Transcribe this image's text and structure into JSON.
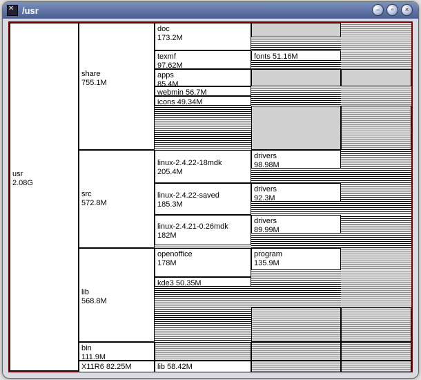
{
  "window": {
    "title": "/usr"
  },
  "root": {
    "name": "usr",
    "size": "2.08G"
  },
  "l2": {
    "share": {
      "name": "share",
      "size": "755.1M"
    },
    "src": {
      "name": "src",
      "size": "572.8M"
    },
    "lib": {
      "name": "lib",
      "size": "568.8M"
    },
    "bin": {
      "name": "bin",
      "size": "111.9M"
    },
    "x11r6": {
      "name": "X11R6 82.25M"
    }
  },
  "l3": {
    "doc": {
      "name": "doc",
      "size": "173.2M"
    },
    "texmf": {
      "name": "texmf",
      "size": "97.62M"
    },
    "apps": {
      "name": "apps",
      "size": "85.4M"
    },
    "webmin": {
      "label": "webmin 56.7M"
    },
    "icons": {
      "label": "icons 49.34M"
    },
    "linux1": {
      "name": "linux-2.4.22-18mdk",
      "size": "205.4M"
    },
    "linux2": {
      "name": "linux-2.4.22-saved",
      "size": "185.3M"
    },
    "linux3": {
      "name": "linux-2.4.21-0.26mdk",
      "size": "182M"
    },
    "openoffice": {
      "name": "openoffice",
      "size": "178M"
    },
    "kde3": {
      "label": "kde3 50.35M"
    },
    "x11lib": {
      "label": "lib 58.42M"
    }
  },
  "l4": {
    "fonts": {
      "label": "fonts 51.16M"
    },
    "drivers1": {
      "name": "drivers",
      "size": "98.98M"
    },
    "drivers2": {
      "name": "drivers",
      "size": "92.3M"
    },
    "drivers3": {
      "name": "drivers",
      "size": "89.99M"
    },
    "program": {
      "name": "program",
      "size": "135.9M"
    }
  },
  "chart_data": {
    "type": "treemap",
    "path": "/usr",
    "total": "2.08G",
    "children": [
      {
        "name": "share",
        "size": "755.1M",
        "children": [
          {
            "name": "doc",
            "size": "173.2M"
          },
          {
            "name": "texmf",
            "size": "97.62M",
            "children": [
              {
                "name": "fonts",
                "size": "51.16M"
              }
            ]
          },
          {
            "name": "apps",
            "size": "85.4M"
          },
          {
            "name": "webmin",
            "size": "56.7M"
          },
          {
            "name": "icons",
            "size": "49.34M"
          }
        ]
      },
      {
        "name": "src",
        "size": "572.8M",
        "children": [
          {
            "name": "linux-2.4.22-18mdk",
            "size": "205.4M",
            "children": [
              {
                "name": "drivers",
                "size": "98.98M"
              }
            ]
          },
          {
            "name": "linux-2.4.22-saved",
            "size": "185.3M",
            "children": [
              {
                "name": "drivers",
                "size": "92.3M"
              }
            ]
          },
          {
            "name": "linux-2.4.21-0.26mdk",
            "size": "182M",
            "children": [
              {
                "name": "drivers",
                "size": "89.99M"
              }
            ]
          }
        ]
      },
      {
        "name": "lib",
        "size": "568.8M",
        "children": [
          {
            "name": "openoffice",
            "size": "178M",
            "children": [
              {
                "name": "program",
                "size": "135.9M"
              }
            ]
          },
          {
            "name": "kde3",
            "size": "50.35M"
          }
        ]
      },
      {
        "name": "bin",
        "size": "111.9M"
      },
      {
        "name": "X11R6",
        "size": "82.25M",
        "children": [
          {
            "name": "lib",
            "size": "58.42M"
          }
        ]
      }
    ]
  }
}
